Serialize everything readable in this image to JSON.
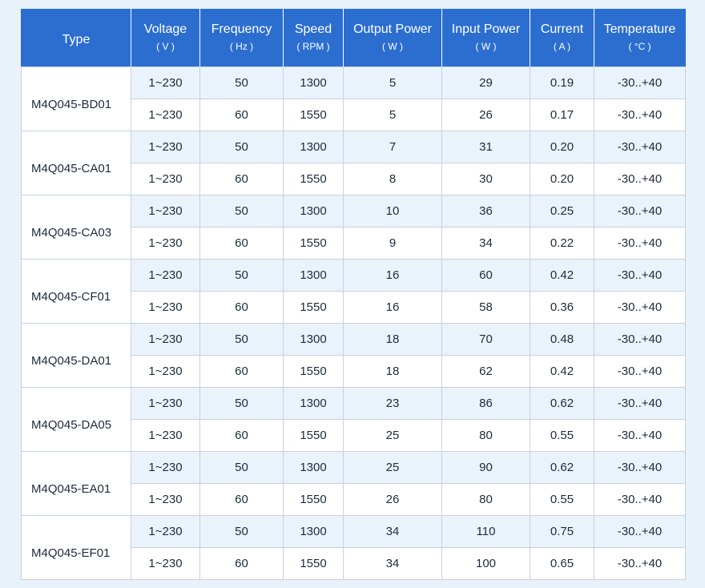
{
  "table": {
    "headers": [
      {
        "name": "Type",
        "unit": ""
      },
      {
        "name": "Voltage",
        "unit": "( V )"
      },
      {
        "name": "Frequency",
        "unit": "( Hz )"
      },
      {
        "name": "Speed",
        "unit": "( RPM )"
      },
      {
        "name": "Output Power",
        "unit": "( W )"
      },
      {
        "name": "Input Power",
        "unit": "( W )"
      },
      {
        "name": "Current",
        "unit": "( A )"
      },
      {
        "name": "Temperature",
        "unit": "( °C )"
      }
    ],
    "groups": [
      {
        "type": "M4Q045-BD01",
        "rows": [
          [
            "1~230",
            "50",
            "1300",
            "5",
            "29",
            "0.19",
            "-30..+40"
          ],
          [
            "1~230",
            "60",
            "1550",
            "5",
            "26",
            "0.17",
            "-30..+40"
          ]
        ]
      },
      {
        "type": "M4Q045-CA01",
        "rows": [
          [
            "1~230",
            "50",
            "1300",
            "7",
            "31",
            "0.20",
            "-30..+40"
          ],
          [
            "1~230",
            "60",
            "1550",
            "8",
            "30",
            "0.20",
            "-30..+40"
          ]
        ]
      },
      {
        "type": "M4Q045-CA03",
        "rows": [
          [
            "1~230",
            "50",
            "1300",
            "10",
            "36",
            "0.25",
            "-30..+40"
          ],
          [
            "1~230",
            "60",
            "1550",
            "9",
            "34",
            "0.22",
            "-30..+40"
          ]
        ]
      },
      {
        "type": "M4Q045-CF01",
        "rows": [
          [
            "1~230",
            "50",
            "1300",
            "16",
            "60",
            "0.42",
            "-30..+40"
          ],
          [
            "1~230",
            "60",
            "1550",
            "16",
            "58",
            "0.36",
            "-30..+40"
          ]
        ]
      },
      {
        "type": "M4Q045-DA01",
        "rows": [
          [
            "1~230",
            "50",
            "1300",
            "18",
            "70",
            "0.48",
            "-30..+40"
          ],
          [
            "1~230",
            "60",
            "1550",
            "18",
            "62",
            "0.42",
            "-30..+40"
          ]
        ]
      },
      {
        "type": "M4Q045-DA05",
        "rows": [
          [
            "1~230",
            "50",
            "1300",
            "23",
            "86",
            "0.62",
            "-30..+40"
          ],
          [
            "1~230",
            "60",
            "1550",
            "25",
            "80",
            "0.55",
            "-30..+40"
          ]
        ]
      },
      {
        "type": "M4Q045-EA01",
        "rows": [
          [
            "1~230",
            "50",
            "1300",
            "25",
            "90",
            "0.62",
            "-30..+40"
          ],
          [
            "1~230",
            "60",
            "1550",
            "26",
            "80",
            "0.55",
            "-30..+40"
          ]
        ]
      },
      {
        "type": "M4Q045-EF01",
        "rows": [
          [
            "1~230",
            "50",
            "1300",
            "34",
            "110",
            "0.75",
            "-30..+40"
          ],
          [
            "1~230",
            "60",
            "1550",
            "34",
            "100",
            "0.65",
            "-30..+40"
          ]
        ]
      }
    ]
  },
  "colors": {
    "header_bg": "#2b6ed0",
    "row_tint": "#eaf2fc",
    "page_bg": "#e9f1fb"
  }
}
